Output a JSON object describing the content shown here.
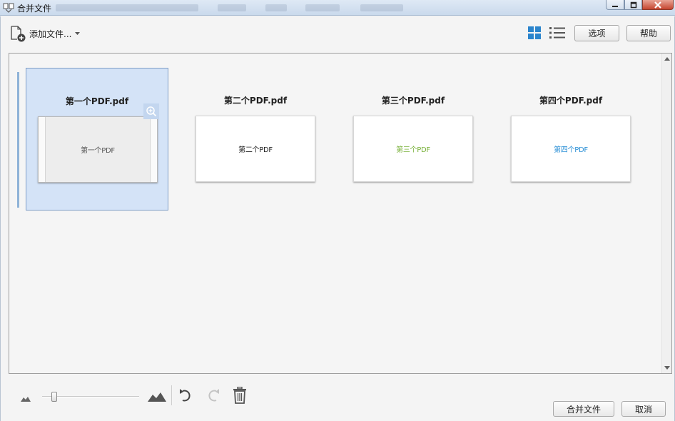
{
  "window": {
    "title": "合并文件",
    "controls": [
      "minimize",
      "maximize",
      "close"
    ]
  },
  "toolbar": {
    "add_files_label": "添加文件...",
    "add_files_icon": "add-file-icon",
    "view_grid_icon": "grid-view-icon",
    "view_list_icon": "list-view-icon",
    "options_label": "选项",
    "help_label": "帮助"
  },
  "files": [
    {
      "name": "第一个PDF.pdf",
      "page_text": "第一个PDF",
      "text_color": "#555555",
      "selected": true
    },
    {
      "name": "第二个PDF.pdf",
      "page_text": "第二个PDF",
      "text_color": "#222222",
      "selected": false
    },
    {
      "name": "第三个PDF.pdf",
      "page_text": "第三个PDF",
      "text_color": "#79b13a",
      "selected": false
    },
    {
      "name": "第四个PDF.pdf",
      "page_text": "第四个PDF",
      "text_color": "#2a8fd6",
      "selected": false
    }
  ],
  "bottom": {
    "zoom_level": 0.1,
    "merge_label": "合并文件",
    "cancel_label": "取消"
  },
  "colors": {
    "accent": "#2b84cc",
    "selection": "#d4e3f7"
  }
}
